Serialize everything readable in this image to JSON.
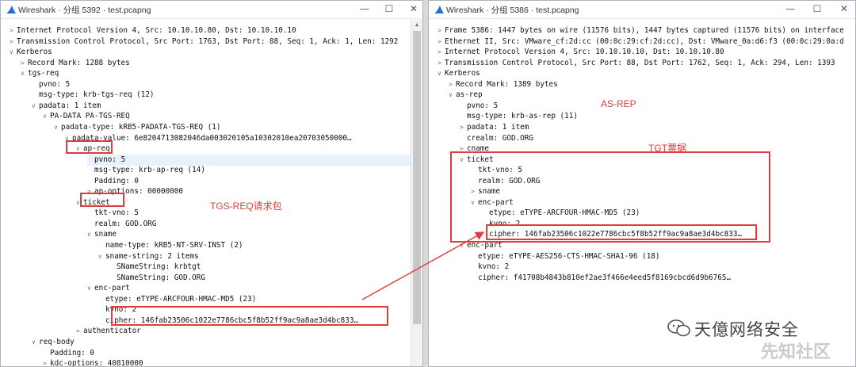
{
  "left": {
    "title": "Wireshark · 分组 5392 · test.pcapng",
    "rows": [
      {
        "arrow": ">",
        "text": "Internet Protocol Version 4, Src: 10.10.10.80, Dst: 10.10.10.10"
      },
      {
        "arrow": ">",
        "text": "Transmission Control Protocol, Src Port: 1763, Dst Port: 88, Seq: 1, Ack: 1, Len: 1292"
      },
      {
        "arrow": "∨",
        "text": "Kerberos"
      },
      {
        "arrow": ">",
        "text": "Record Mark: 1288 bytes"
      },
      {
        "arrow": "∨",
        "text": "tgs-req"
      },
      {
        "arrow": "",
        "text": "pvno: 5"
      },
      {
        "arrow": "",
        "text": "msg-type: krb-tgs-req (12)"
      },
      {
        "arrow": "∨",
        "text": "padata: 1 item"
      },
      {
        "arrow": "∨",
        "text": "PA-DATA PA-TGS-REQ"
      },
      {
        "arrow": "∨",
        "text": "padata-type: kRB5-PADATA-TGS-REQ (1)"
      },
      {
        "arrow": "∨",
        "text": "padata-value: 6e8204713082046da003020105a10302010ea20703050000…"
      },
      {
        "arrow": "∨",
        "text": "ap-req"
      },
      {
        "arrow": "",
        "text": "pvno: 5"
      },
      {
        "arrow": "",
        "text": "msg-type: krb-ap-req (14)"
      },
      {
        "arrow": "",
        "text": "Padding: 0"
      },
      {
        "arrow": ">",
        "text": "ap-options: 00000000"
      },
      {
        "arrow": "∨",
        "text": "ticket"
      },
      {
        "arrow": "",
        "text": "tkt-vno: 5"
      },
      {
        "arrow": "",
        "text": "realm: GOD.ORG"
      },
      {
        "arrow": "∨",
        "text": "sname"
      },
      {
        "arrow": "",
        "text": "name-type: kRB5-NT-SRV-INST (2)"
      },
      {
        "arrow": "∨",
        "text": "sname-string: 2 items"
      },
      {
        "arrow": "",
        "text": "SNameString: krbtgt"
      },
      {
        "arrow": "",
        "text": "SNameString: GOD.ORG"
      },
      {
        "arrow": "∨",
        "text": "enc-part"
      },
      {
        "arrow": "",
        "text": "etype: eTYPE-ARCFOUR-HMAC-MD5 (23)"
      },
      {
        "arrow": "",
        "text": "kvno: 2"
      },
      {
        "arrow": "",
        "text": "cipher: 146fab23506c1022e7786cbc5f8b52ff9ac9a8ae3d4bc833…"
      },
      {
        "arrow": ">",
        "text": "authenticator"
      },
      {
        "arrow": "∨",
        "text": "req-body"
      },
      {
        "arrow": "",
        "text": "Padding: 0"
      },
      {
        "arrow": ">",
        "text": "kdc-options: 40810000"
      }
    ]
  },
  "right": {
    "title": "Wireshark · 分组 5386 · test.pcapng",
    "rows": [
      {
        "arrow": ">",
        "text": "Frame 5386: 1447 bytes on wire (11576 bits), 1447 bytes captured (11576 bits) on interface"
      },
      {
        "arrow": ">",
        "text": "Ethernet II, Src: VMware_cf:2d:cc (00:0c:29:cf:2d:cc), Dst: VMware_0a:d6:f3 (00:0c:29:0a:d"
      },
      {
        "arrow": ">",
        "text": "Internet Protocol Version 4, Src: 10.10.10.10, Dst: 10.10.10.80"
      },
      {
        "arrow": ">",
        "text": "Transmission Control Protocol, Src Port: 88, Dst Port: 1762, Seq: 1, Ack: 294, Len: 1393"
      },
      {
        "arrow": "∨",
        "text": "Kerberos"
      },
      {
        "arrow": ">",
        "text": "Record Mark: 1389 bytes"
      },
      {
        "arrow": "∨",
        "text": "as-rep"
      },
      {
        "arrow": "",
        "text": "pvno: 5"
      },
      {
        "arrow": "",
        "text": "msg-type: krb-as-rep (11)"
      },
      {
        "arrow": ">",
        "text": "padata: 1 item"
      },
      {
        "arrow": "",
        "text": "crealm: GOD.ORG"
      },
      {
        "arrow": ">",
        "text": "cname"
      },
      {
        "arrow": "∨",
        "text": "ticket"
      },
      {
        "arrow": "",
        "text": "tkt-vno: 5"
      },
      {
        "arrow": "",
        "text": "realm: GOD.ORG"
      },
      {
        "arrow": ">",
        "text": "sname"
      },
      {
        "arrow": "∨",
        "text": "enc-part"
      },
      {
        "arrow": "",
        "text": "etype: eTYPE-ARCFOUR-HMAC-MD5 (23)"
      },
      {
        "arrow": "",
        "text": "kvno: 2"
      },
      {
        "arrow": "",
        "text": "cipher: 146fab23506c1022e7786cbc5f8b52ff9ac9a8ae3d4bc833…"
      },
      {
        "arrow": "∨",
        "text": "enc-part"
      },
      {
        "arrow": "",
        "text": "etype: eTYPE-AES256-CTS-HMAC-SHA1-96 (18)"
      },
      {
        "arrow": "",
        "text": "kvno: 2"
      },
      {
        "arrow": "",
        "text": "cipher: f41708b4843b810ef2ae3f466e4eed5f8169cbcd6d9b6765…"
      }
    ]
  },
  "annotations": {
    "tgs_req_label": "TGS-REQ请求包",
    "as_rep_label": "AS-REP",
    "tgt_label": "TGT票据"
  },
  "watermark": {
    "text": "天億网络安全",
    "stamp": "先知社区"
  },
  "colors": {
    "annotation_red": "#e23b3b",
    "selected_row": "#e8f1fb",
    "wireshark_blue": "#1e6fd9"
  }
}
